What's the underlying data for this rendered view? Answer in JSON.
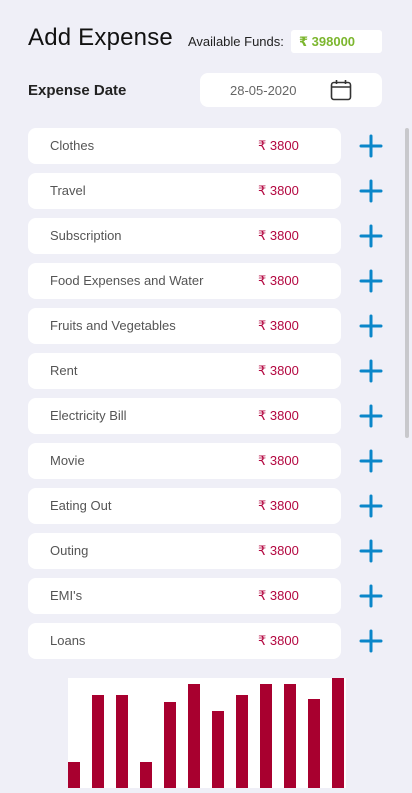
{
  "header": {
    "title": "Add Expense",
    "funds_label": "Available Funds:",
    "funds_value": "₹ 398000",
    "funds_color": "#7cb62e"
  },
  "date": {
    "label": "Expense Date",
    "value": "28-05-2020",
    "icon": "calendar-icon"
  },
  "expenses": [
    {
      "name": "Clothes",
      "amount": "₹ 3800"
    },
    {
      "name": "Travel",
      "amount": "₹ 3800"
    },
    {
      "name": "Subscription",
      "amount": "₹ 3800"
    },
    {
      "name": "Food Expenses and Water",
      "amount": "₹ 3800"
    },
    {
      "name": "Fruits and Vegetables",
      "amount": "₹ 3800"
    },
    {
      "name": "Rent",
      "amount": "₹ 3800"
    },
    {
      "name": "Electricity Bill",
      "amount": "₹ 3800"
    },
    {
      "name": "Movie",
      "amount": "₹ 3800"
    },
    {
      "name": "Eating Out",
      "amount": "₹ 3800"
    },
    {
      "name": "Outing",
      "amount": "₹ 3800"
    },
    {
      "name": "EMI's",
      "amount": "₹ 3800"
    },
    {
      "name": "Loans",
      "amount": "₹ 3800"
    }
  ],
  "add_icon": "plus-icon",
  "colors": {
    "amount": "#b3063f",
    "add_button": "#0a86c9",
    "bar": "#a8002f"
  },
  "chart_data": {
    "type": "bar",
    "values": [
      26,
      93,
      93,
      26,
      86,
      104,
      77,
      93,
      104,
      104,
      89,
      110
    ],
    "ylim": [
      0,
      110
    ]
  }
}
